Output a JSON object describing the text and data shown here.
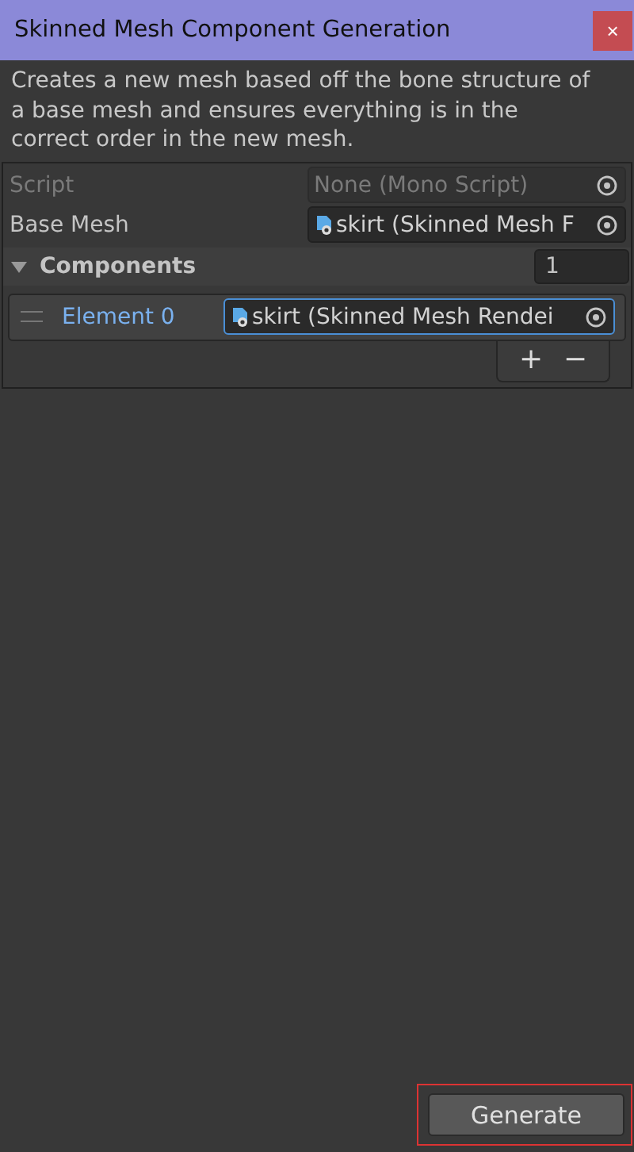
{
  "window": {
    "title": "Skinned Mesh Component Generation",
    "close": "×"
  },
  "description": "Creates a new mesh based off the bone structure of a base mesh and ensures everything is in the correct order in the new mesh.",
  "fields": [
    {
      "label": "Script",
      "value": "None (Mono Script)",
      "disabled": true,
      "has_asset_icon": false
    },
    {
      "label": "Base Mesh",
      "value": "skirt (Skinned Mesh F",
      "disabled": false,
      "has_asset_icon": true
    }
  ],
  "list": {
    "label": "Components",
    "expanded": true,
    "size": "1",
    "add": "+",
    "remove": "−",
    "elements": [
      {
        "label": "Element 0",
        "value": "skirt (Skinned Mesh Rendei",
        "selected": true
      }
    ]
  },
  "generate_button": "Generate"
}
